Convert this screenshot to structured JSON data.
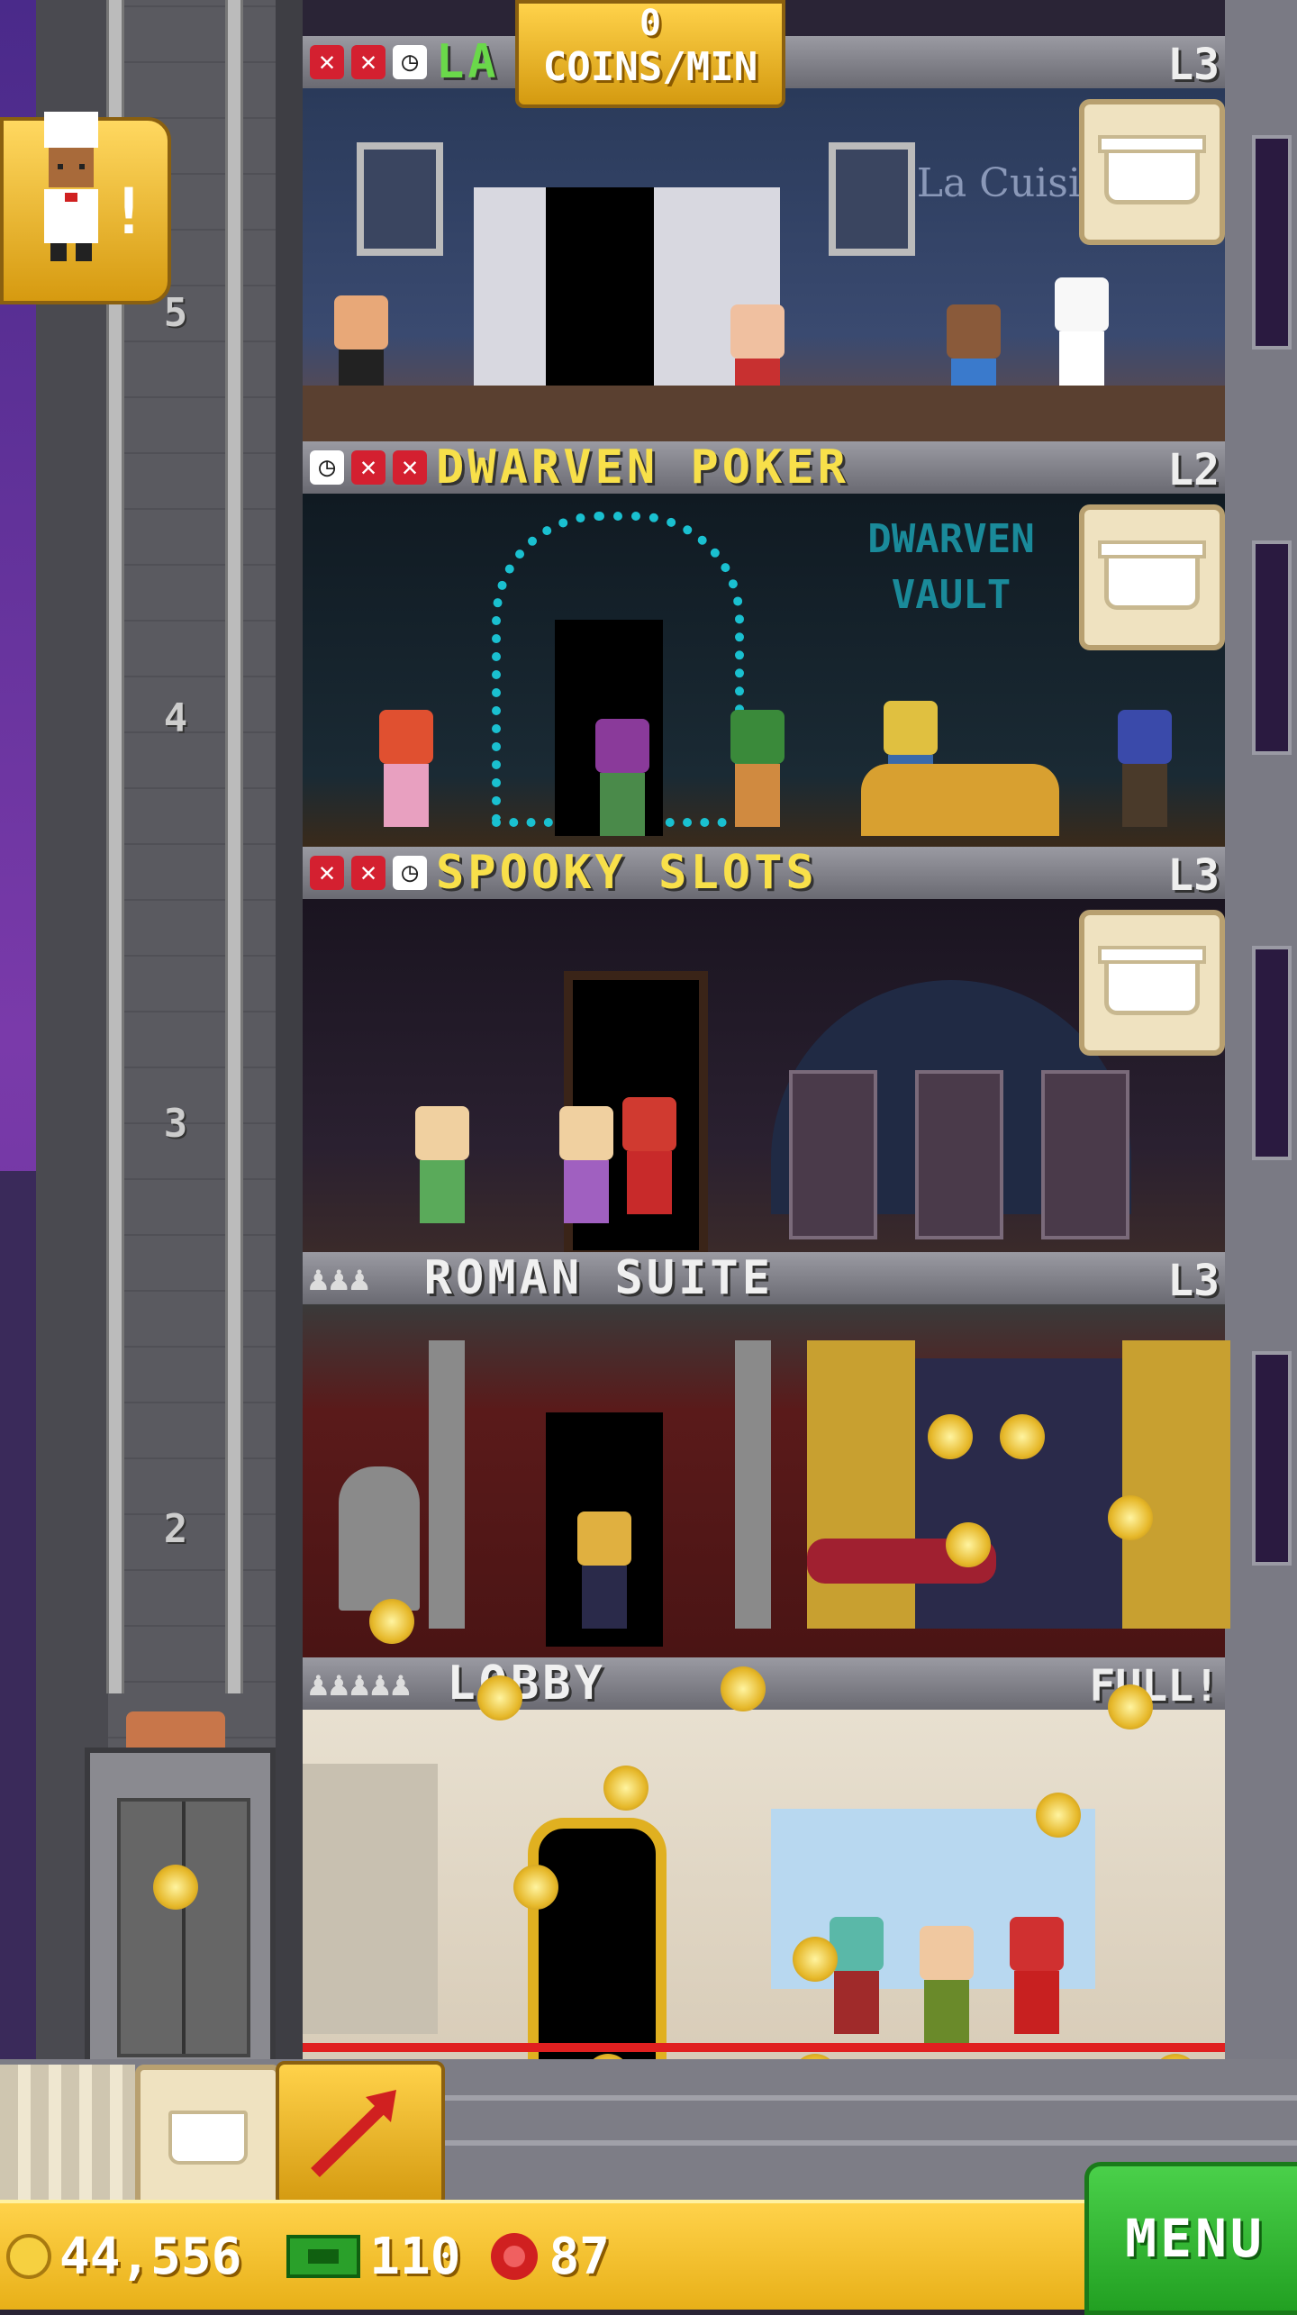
{
  "coins_per_min": {
    "value": "0",
    "label": "COINS/MIN"
  },
  "floors": [
    {
      "id": "5",
      "name": "LA CUISINE",
      "visible_name": "LA",
      "level": "L3",
      "stock": [
        "x",
        "x",
        "clock"
      ]
    },
    {
      "id": "4",
      "name": "DWARVEN POKER",
      "level": "L2",
      "stock": [
        "clock",
        "x",
        "x"
      ]
    },
    {
      "id": "3",
      "name": "SPOOKY SLOTS",
      "level": "L3",
      "stock": [
        "x",
        "x",
        "clock"
      ]
    },
    {
      "id": "2",
      "name": "ROMAN SUITE",
      "level": "L3"
    },
    {
      "id": "1",
      "name": "LOBBY",
      "level": "FULL!"
    }
  ],
  "floor_numbers": [
    "5",
    "4",
    "3",
    "2"
  ],
  "sign_text": {
    "cuisine": "La Cuisine",
    "dwarven": "DWARVEN VAULT"
  },
  "stats": {
    "coins": "44,556",
    "bux": "110",
    "chips": "87"
  },
  "menu_label": "MENU",
  "colors": {
    "gold": "#ffd24a",
    "menu_green": "#32b832",
    "title_yellow": "#f8e04a",
    "title_green": "#6ad84a",
    "title_white": "#f0f0f0"
  }
}
